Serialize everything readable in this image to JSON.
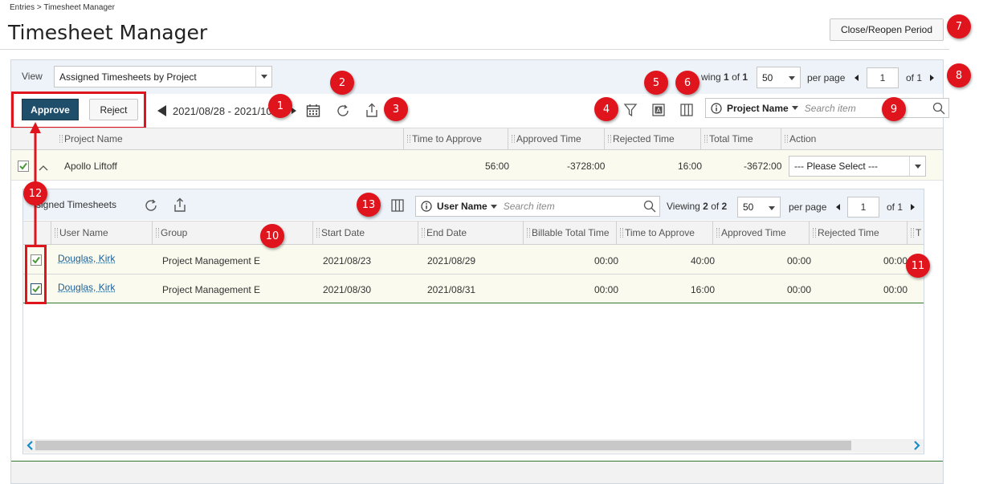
{
  "breadcrumb": "Entries > Timesheet Manager",
  "page_title": "Timesheet Manager",
  "close_reopen_label": "Close/Reopen Period",
  "callouts": [
    "1",
    "2",
    "3",
    "4",
    "5",
    "6",
    "7",
    "8",
    "9",
    "10",
    "11",
    "12",
    "13"
  ],
  "view": {
    "label": "View",
    "selected": "Assigned Timesheets by Project"
  },
  "pager_top": {
    "viewing_prefix": "wing",
    "viewing_count": "1",
    "of_word": "of",
    "viewing_total": "1",
    "per_page_value": "50",
    "per_page_label": "per page",
    "page_value": "1",
    "of_pages": "of 1"
  },
  "toolbar": {
    "approve_label": "Approve",
    "reject_label": "Reject",
    "date_range": "2021/08/28 - 2021/10",
    "search_field": "Project Name",
    "search_placeholder": "Search item"
  },
  "main_table": {
    "columns": [
      "Project Name",
      "Time to Approve",
      "Approved Time",
      "Rejected Time",
      "Total Time",
      "Action"
    ],
    "row": {
      "project": "Apollo Liftoff",
      "time_to_approve": "56:00",
      "approved_time": "-3728:00",
      "rejected_time": "16:00",
      "total_time": "-3672:00",
      "action": "--- Please Select ---"
    }
  },
  "sub": {
    "title": "signed Timesheets",
    "search_field": "User Name",
    "search_placeholder": "Search item",
    "viewing_label": "Viewing",
    "viewing_count": "2",
    "of_word": "of",
    "viewing_total": "2",
    "per_page_value": "50",
    "per_page_label": "per page",
    "page_value": "1",
    "of_pages": "of 1",
    "columns": [
      "User Name",
      "Group",
      "Start Date",
      "End Date",
      "Billable Total Time",
      "Time to Approve",
      "Approved Time",
      "Rejected Time",
      "T"
    ],
    "rows": [
      {
        "user": "Douglas, Kirk",
        "group": "Project Management E",
        "start": "2021/08/23",
        "end": "2021/08/29",
        "billable": "00:00",
        "to_approve": "40:00",
        "approved": "00:00",
        "rejected": "00:00"
      },
      {
        "user": "Douglas, Kirk",
        "group": "Project Management E",
        "start": "2021/08/30",
        "end": "2021/08/31",
        "billable": "00:00",
        "to_approve": "16:00",
        "approved": "00:00",
        "rejected": "00:00"
      }
    ]
  },
  "colors": {
    "approve_bg": "#1f4e6b",
    "callout_red": "#e0141c",
    "row_bg": "#fafbee",
    "header_bg": "#edf3f9",
    "check_green": "#4a9a3a"
  }
}
